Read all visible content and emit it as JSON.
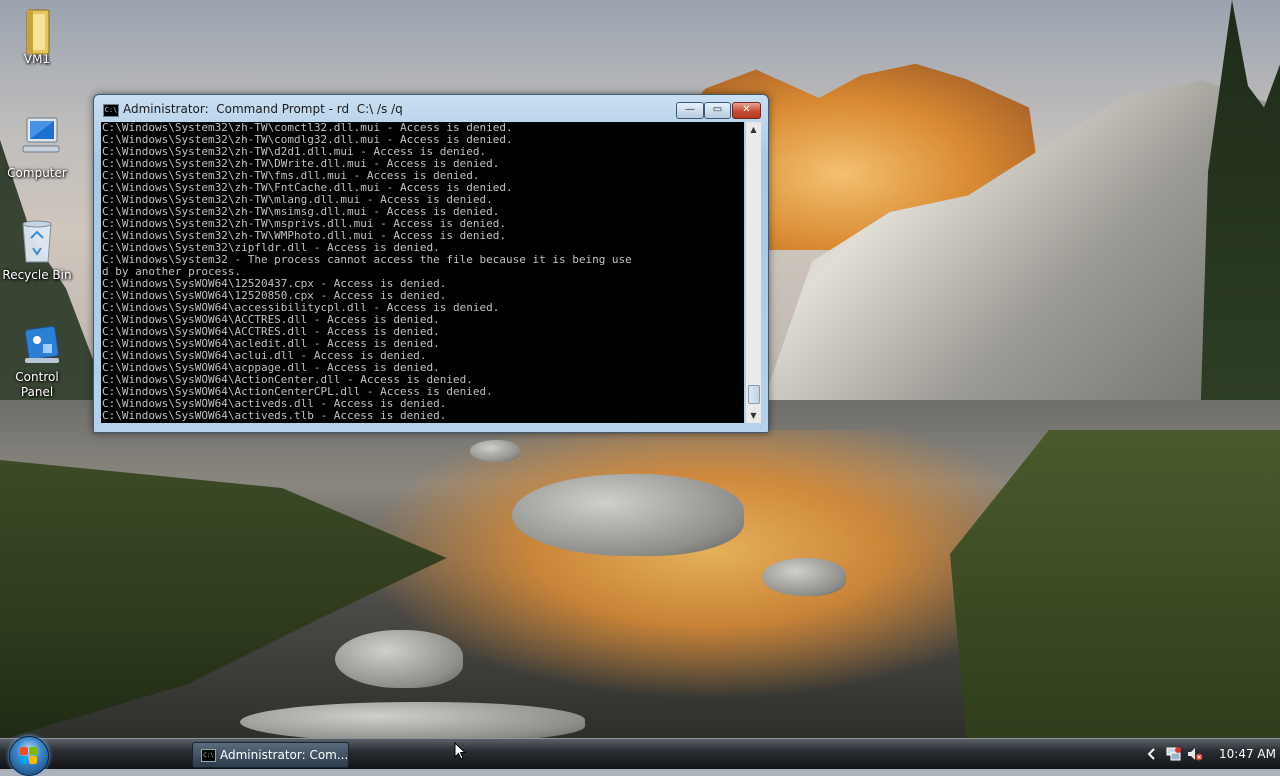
{
  "desktop": {
    "icons": [
      {
        "label": "VM1",
        "icon": "folder-icon"
      },
      {
        "label": "Computer",
        "icon": "computer-icon"
      },
      {
        "label": "Recycle Bin",
        "icon": "recycle-bin-icon"
      },
      {
        "label": "Control Panel",
        "icon": "control-panel-icon"
      }
    ]
  },
  "cmd_window": {
    "title": "Administrator:  Command Prompt - rd  C:\\ /s /q",
    "icon_text": "C:\\",
    "buttons": {
      "minimize": "—",
      "maximize": "▭",
      "close": "✕"
    },
    "lines": [
      "C:\\Windows\\System32\\zh-TW\\comctl32.dll.mui - Access is denied.",
      "C:\\Windows\\System32\\zh-TW\\comdlg32.dll.mui - Access is denied.",
      "C:\\Windows\\System32\\zh-TW\\d2d1.dll.mui - Access is denied.",
      "C:\\Windows\\System32\\zh-TW\\DWrite.dll.mui - Access is denied.",
      "C:\\Windows\\System32\\zh-TW\\fms.dll.mui - Access is denied.",
      "C:\\Windows\\System32\\zh-TW\\FntCache.dll.mui - Access is denied.",
      "C:\\Windows\\System32\\zh-TW\\mlang.dll.mui - Access is denied.",
      "C:\\Windows\\System32\\zh-TW\\msimsg.dll.mui - Access is denied.",
      "C:\\Windows\\System32\\zh-TW\\msprivs.dll.mui - Access is denied.",
      "C:\\Windows\\System32\\zh-TW\\WMPhoto.dll.mui - Access is denied.",
      "C:\\Windows\\System32\\zipfldr.dll - Access is denied.",
      "C:\\Windows\\System32 - The process cannot access the file because it is being use",
      "d by another process.",
      "C:\\Windows\\SysWOW64\\12520437.cpx - Access is denied.",
      "C:\\Windows\\SysWOW64\\12520850.cpx - Access is denied.",
      "C:\\Windows\\SysWOW64\\accessibilitycpl.dll - Access is denied.",
      "C:\\Windows\\SysWOW64\\ACCTRES.dll - Access is denied.",
      "C:\\Windows\\SysWOW64\\ACCTRES.dll - Access is denied.",
      "C:\\Windows\\SysWOW64\\acledit.dll - Access is denied.",
      "C:\\Windows\\SysWOW64\\aclui.dll - Access is denied.",
      "C:\\Windows\\SysWOW64\\acppage.dll - Access is denied.",
      "C:\\Windows\\SysWOW64\\ActionCenter.dll - Access is denied.",
      "C:\\Windows\\SysWOW64\\ActionCenterCPL.dll - Access is denied.",
      "C:\\Windows\\SysWOW64\\activeds.dll - Access is denied.",
      "C:\\Windows\\SysWOW64\\activeds.tlb - Access is denied."
    ]
  },
  "taskbar": {
    "task_label": "Administrator: Com...",
    "task_icon_text": "C:\\",
    "clock": "10:47 AM",
    "tray_icons": [
      "chevron-left-icon",
      "network-icon",
      "volume-muted-icon"
    ]
  },
  "colors": {
    "console_bg": "#000000",
    "console_fg": "#c0c0c0",
    "titlebar": "#b6d1ea",
    "close_button": "#c74a34"
  }
}
